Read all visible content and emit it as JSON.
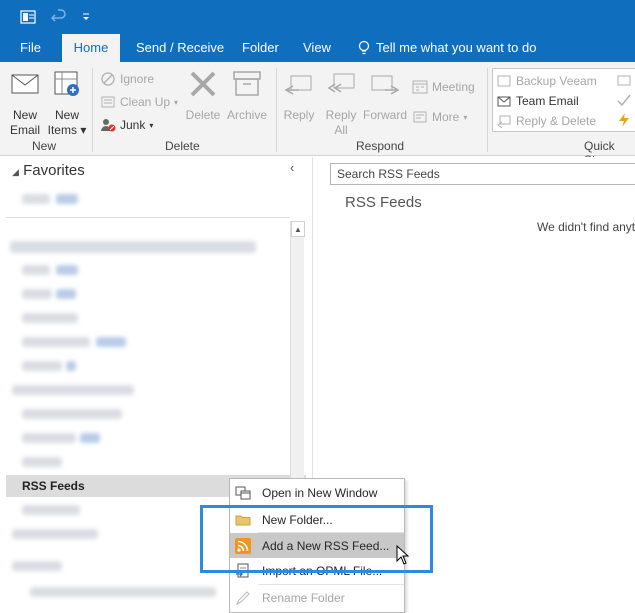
{
  "quick_access": {
    "icons": [
      "outlook-app-icon",
      "undo-icon",
      "customize-toolbar-icon"
    ]
  },
  "tabs": [
    {
      "label": "File",
      "active": false
    },
    {
      "label": "Home",
      "active": true
    },
    {
      "label": "Send / Receive",
      "active": false
    },
    {
      "label": "Folder",
      "active": false
    },
    {
      "label": "View",
      "active": false
    }
  ],
  "tell_me": "Tell me what you want to do",
  "ribbon": {
    "new_group": {
      "label": "New",
      "new_email_line1": "New",
      "new_email_line2": "Email",
      "new_items_line1": "New",
      "new_items_line2": "Items"
    },
    "delete_group": {
      "label": "Delete",
      "ignore": "Ignore",
      "clean_up": "Clean Up",
      "junk": "Junk",
      "delete": "Delete",
      "archive": "Archive"
    },
    "respond_group": {
      "label": "Respond",
      "reply": "Reply",
      "reply_all_line1": "Reply",
      "reply_all_line2": "All",
      "forward": "Forward",
      "meeting": "Meeting",
      "more": "More"
    },
    "quick_steps_group": {
      "label": "Quick Step",
      "items": [
        "Backup Veeam",
        "Team Email",
        "Reply & Delete"
      ]
    }
  },
  "folder_pane": {
    "favorites": "Favorites",
    "rss_feeds": "RSS Feeds"
  },
  "main": {
    "search_placeholder": "Search RSS Feeds",
    "header": "RSS Feeds",
    "empty_message": "We didn't find anyt"
  },
  "context_menu": [
    {
      "label": "Open in New Window",
      "icon": "open-window-icon",
      "disabled": false,
      "highlight": false
    },
    {
      "label": "New Folder...",
      "icon": "folder-icon",
      "disabled": false,
      "highlight": false
    },
    {
      "label": "Add a New RSS Feed...",
      "icon": "rss-icon",
      "disabled": false,
      "highlight": true
    },
    {
      "label": "Import an OPML File...",
      "icon": "import-icon",
      "disabled": false,
      "highlight": false
    },
    {
      "label": "Rename Folder",
      "icon": "rename-icon",
      "disabled": true,
      "highlight": false
    }
  ],
  "colors": {
    "brand_blue": "#106ebe",
    "highlight_border": "#2e8ae0",
    "rss_orange": "#f29423"
  }
}
